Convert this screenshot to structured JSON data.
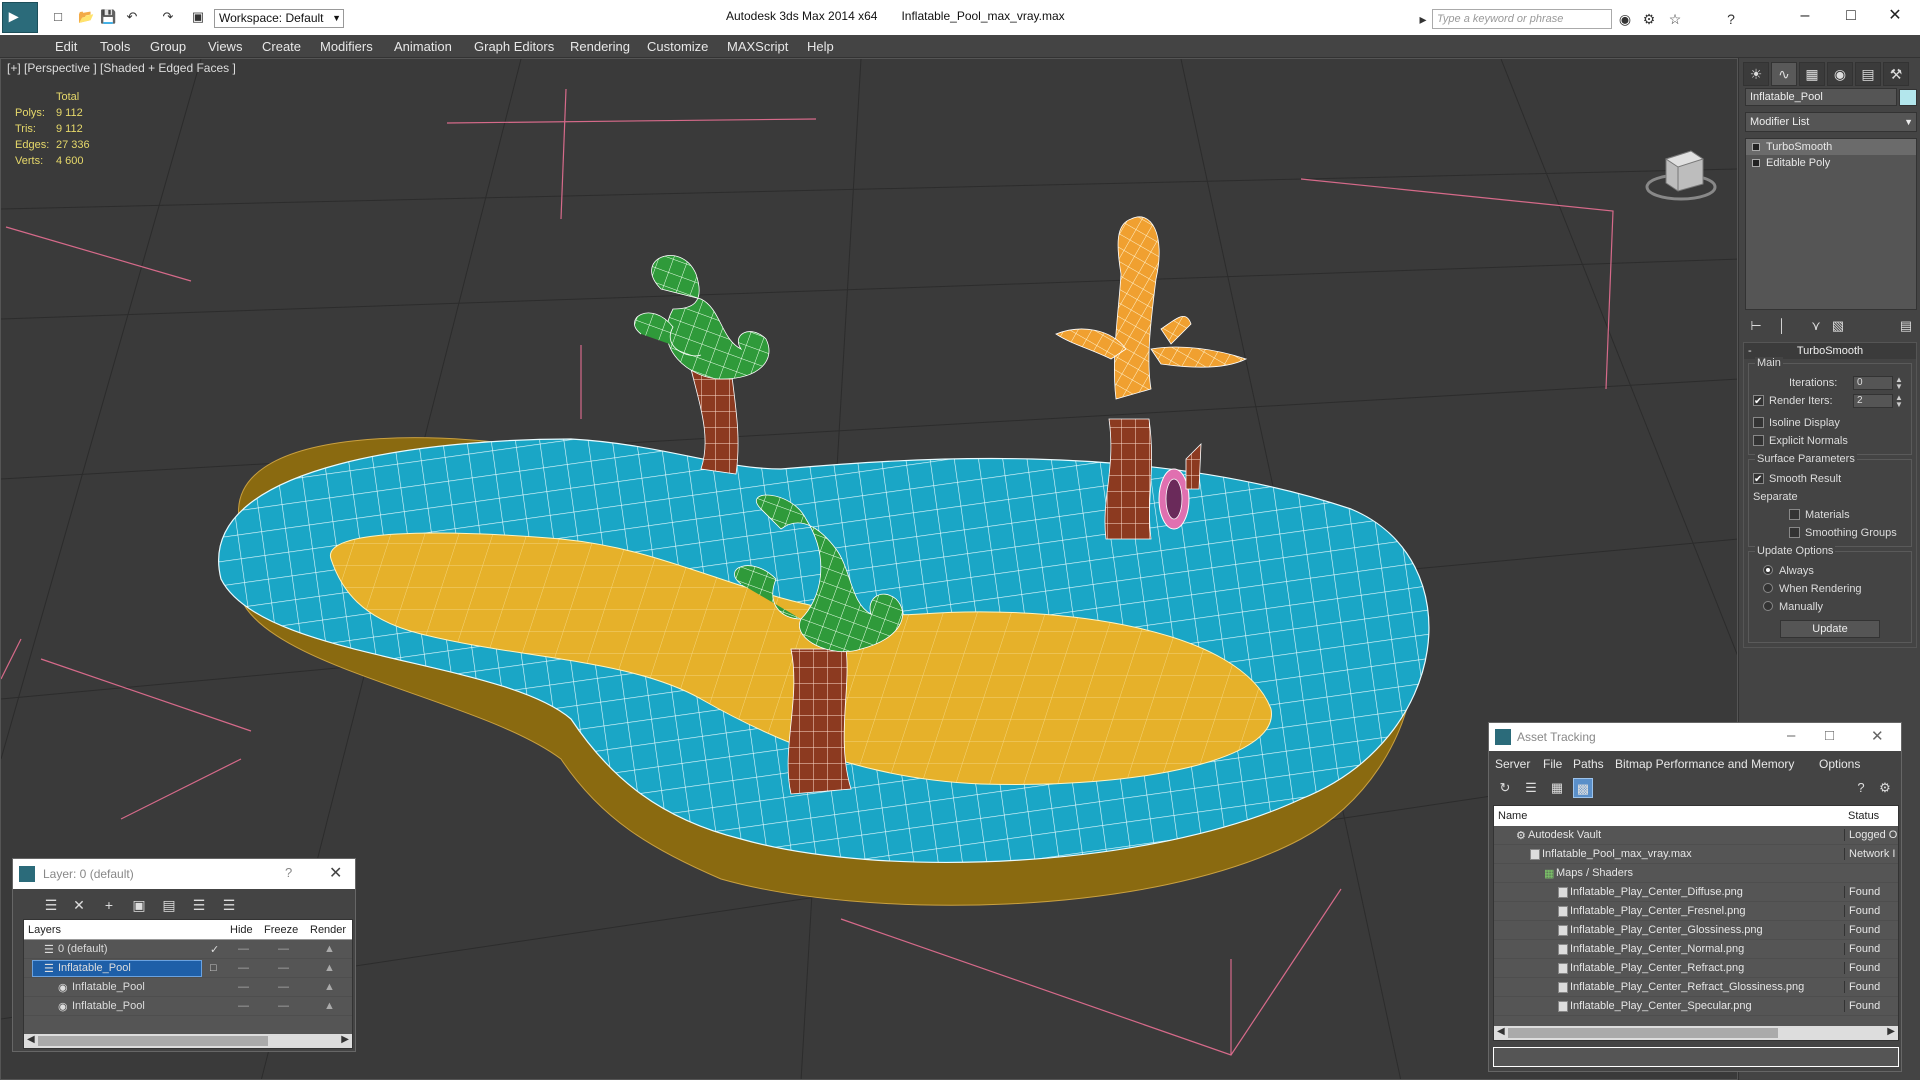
{
  "app": {
    "title": "Autodesk 3ds Max  2014 x64",
    "file": "Inflatable_Pool_max_vray.max",
    "workspace": "Workspace: Default",
    "search_placeholder": "Type a keyword or phrase"
  },
  "menu": [
    "Edit",
    "Tools",
    "Group",
    "Views",
    "Create",
    "Modifiers",
    "Animation",
    "Graph Editors",
    "Rendering",
    "Customize",
    "MAXScript",
    "Help"
  ],
  "viewport": {
    "label": "[+] [Perspective ] [Shaded + Edged Faces ]",
    "stats": {
      "header": "Total",
      "rows": [
        {
          "k": "Polys:",
          "v": "9 112"
        },
        {
          "k": "Tris:",
          "v": "9 112"
        },
        {
          "k": "Edges:",
          "v": "27 336"
        },
        {
          "k": "Verts:",
          "v": "4 600"
        }
      ]
    },
    "colors": {
      "pool": "#1aa6c6",
      "floor": "#e6b12a",
      "trunk": "#8c3a20",
      "leaves": "#2f9a3a",
      "orange": "#f0a030",
      "wire": "#ffffff",
      "bg": "#3a3a3a"
    }
  },
  "command_panel": {
    "object_name": "Inflatable_Pool",
    "modifier_list": "Modifier List",
    "stack": [
      "TurboSmooth",
      "Editable Poly"
    ],
    "rollout_title": "TurboSmooth",
    "main_label": "Main",
    "iterations_label": "Iterations:",
    "iterations_value": "0",
    "render_iters_label": "Render Iters:",
    "render_iters_value": "2",
    "isoline": "Isoline Display",
    "explicit_normals": "Explicit Normals",
    "surface_params": "Surface Parameters",
    "smooth_result": "Smooth Result",
    "separate": "Separate",
    "materials": "Materials",
    "smoothing_groups": "Smoothing Groups",
    "update_options": "Update Options",
    "always": "Always",
    "when_rendering": "When Rendering",
    "manually": "Manually",
    "update_btn": "Update"
  },
  "layer_dialog": {
    "title": "Layer: 0 (default)",
    "help": "?",
    "columns": {
      "layers": "Layers",
      "hide": "Hide",
      "freeze": "Freeze",
      "render": "Render"
    },
    "rows": [
      "0 (default)",
      "Inflatable_Pool",
      "Inflatable_Pool",
      "Inflatable_Pool"
    ]
  },
  "asset_dialog": {
    "title": "Asset Tracking",
    "menu": [
      "Server",
      "File",
      "Paths",
      "Bitmap Performance and Memory",
      "Options"
    ],
    "columns": {
      "name": "Name",
      "status": "Status"
    },
    "rows": [
      {
        "name": "Autodesk Vault",
        "status": "Logged O"
      },
      {
        "name": "Inflatable_Pool_max_vray.max",
        "status": "Network I"
      },
      {
        "name": "Maps / Shaders",
        "status": ""
      },
      {
        "name": "Inflatable_Play_Center_Diffuse.png",
        "status": "Found"
      },
      {
        "name": "Inflatable_Play_Center_Fresnel.png",
        "status": "Found"
      },
      {
        "name": "Inflatable_Play_Center_Glossiness.png",
        "status": "Found"
      },
      {
        "name": "Inflatable_Play_Center_Normal.png",
        "status": "Found"
      },
      {
        "name": "Inflatable_Play_Center_Refract.png",
        "status": "Found"
      },
      {
        "name": "Inflatable_Play_Center_Refract_Glossiness.png",
        "status": "Found"
      },
      {
        "name": "Inflatable_Play_Center_Specular.png",
        "status": "Found"
      }
    ]
  }
}
